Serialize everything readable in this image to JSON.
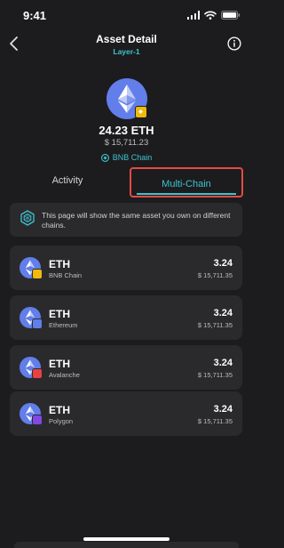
{
  "status_bar": {
    "time": "9:41"
  },
  "nav": {
    "title": "Asset Detail",
    "subtitle": "Layer-1"
  },
  "asset": {
    "amount": "24.23 ETH",
    "value": "$ 15,711.23",
    "chain": "BNB Chain"
  },
  "tabs": [
    {
      "label": "Activity"
    },
    {
      "label": "Multi-Chain"
    }
  ],
  "notice": {
    "text": "This page will show the same asset you own on different chains."
  },
  "assets": [
    {
      "symbol": "ETH",
      "chain": "BNB Chain",
      "amount": "3.24",
      "value": "$ 15,711.35",
      "badge_color": "#f0b90b"
    },
    {
      "symbol": "ETH",
      "chain": "Ethereum",
      "amount": "3.24",
      "value": "$ 15,711.35",
      "badge_color": "#627eea"
    },
    {
      "symbol": "ETH",
      "chain": "Avalanche",
      "amount": "3.24",
      "value": "$ 15,711.35",
      "badge_color": "#e84142"
    },
    {
      "symbol": "ETH",
      "chain": "Polygon",
      "amount": "3.24",
      "value": "$ 15,711.35",
      "badge_color": "#8247e5"
    }
  ],
  "colors": {
    "accent": "#3ec4cf",
    "highlight_border": "#e24b45",
    "eth": "#627eea"
  },
  "icons": [
    "back-arrow-icon",
    "info-icon",
    "ethereum-logo-icon",
    "bnb-badge-icon",
    "bnb-chain-icon",
    "polygon-chain-icon"
  ]
}
